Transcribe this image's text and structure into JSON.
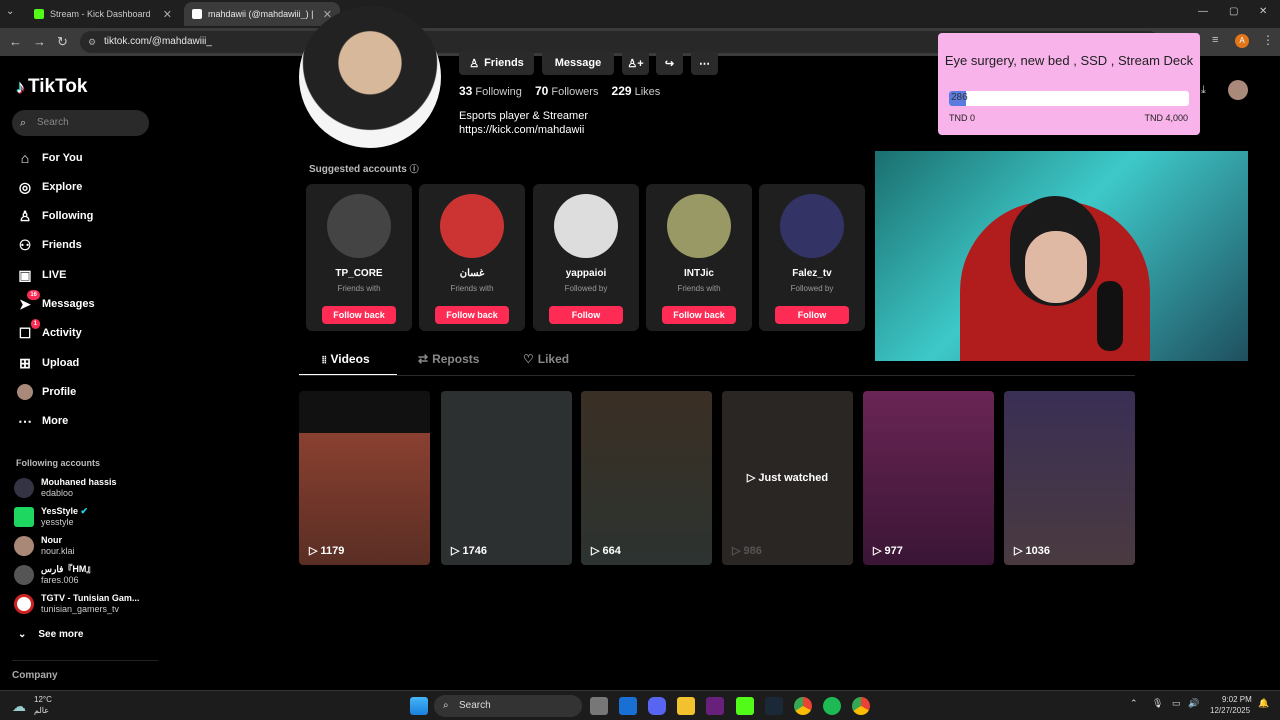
{
  "browser": {
    "tabs": [
      {
        "title": "Stream - Kick Dashboard",
        "active": false,
        "favicon_color": "#53fc18"
      },
      {
        "title": "mahdawii (@mahdawiii_) | TikT",
        "active": true,
        "favicon_color": "#ffffff"
      }
    ],
    "new_tab": "+",
    "url": "tiktok.com/@mahdawiii_",
    "profile_initial": "A"
  },
  "tiktok": {
    "logo": "TikTok",
    "search_placeholder": "Search",
    "nav": [
      {
        "label": "For You",
        "icon": "home-icon"
      },
      {
        "label": "Explore",
        "icon": "compass-icon"
      },
      {
        "label": "Following",
        "icon": "following-icon"
      },
      {
        "label": "Friends",
        "icon": "friends-icon"
      },
      {
        "label": "LIVE",
        "icon": "live-icon"
      },
      {
        "label": "Messages",
        "icon": "messages-icon",
        "badge": "16"
      },
      {
        "label": "Activity",
        "icon": "activity-icon",
        "badge": "1"
      },
      {
        "label": "Upload",
        "icon": "upload-icon"
      },
      {
        "label": "Profile",
        "icon": "profile-icon"
      },
      {
        "label": "More",
        "icon": "more-icon"
      }
    ],
    "following_accounts_title": "Following accounts",
    "following_accounts": [
      {
        "name": "Mouhaned hassis",
        "handle": "edabloo",
        "color": "#334"
      },
      {
        "name": "YesStyle",
        "handle": "yesstyle",
        "color": "#1ed760",
        "verified": true
      },
      {
        "name": "Nour",
        "handle": "nour.klai",
        "color": "#a87"
      },
      {
        "name": "فارس『HM』",
        "handle": "fares.006",
        "color": "#555"
      },
      {
        "name": "TGTV - Tunisian Gam...",
        "handle": "tunisian_gamers_tv",
        "color": "#c22"
      }
    ],
    "see_more": "See more",
    "company": "Company",
    "profile": {
      "buttons": [
        "Friends",
        "Message"
      ],
      "following_count": "33",
      "following_label": "Following",
      "followers_count": "70",
      "followers_label": "Followers",
      "likes_count": "229",
      "likes_label": "Likes",
      "bio": "Esports player & Streamer",
      "link": "https://kick.com/mahdawii",
      "suggested_title": "Suggested accounts"
    },
    "suggested": [
      {
        "name": "TP_CORE",
        "sub": "Friends with",
        "btn": "Follow back",
        "color": "#444"
      },
      {
        "name": "غسان",
        "sub": "Friends with",
        "btn": "Follow back",
        "color": "#c33"
      },
      {
        "name": "yappaioi",
        "sub": "Followed by",
        "btn": "Follow",
        "color": "#ddd"
      },
      {
        "name": "INTJic",
        "sub": "Friends with",
        "btn": "Follow back",
        "color": "#996"
      },
      {
        "name": "Falez_tv",
        "sub": "Followed by",
        "btn": "Follow",
        "color": "#336"
      }
    ],
    "content_tabs": [
      "Videos",
      "Reposts",
      "Liked"
    ],
    "videos": [
      {
        "count": "1179",
        "color": "#5a2e24"
      },
      {
        "count": "1746",
        "color": "#2c3030"
      },
      {
        "count": "664",
        "color": "#3a2f24"
      },
      {
        "count": "986",
        "color": "#2a2624",
        "overlay": "Just watched"
      },
      {
        "count": "977",
        "color": "#5a1f4a"
      },
      {
        "count": "1036",
        "color": "#3a2f55"
      }
    ]
  },
  "donation": {
    "title": "Eye surgery, new bed , SSD , Stream Deck",
    "current": "286",
    "progress_fraction": 0.0715,
    "min_label": "TND 0",
    "max_label": "TND 4,000"
  },
  "taskbar": {
    "weather_temp": "12°C",
    "weather_place": "عالم",
    "search": "Search",
    "time": "9:02 PM",
    "date": "12/27/2025"
  }
}
